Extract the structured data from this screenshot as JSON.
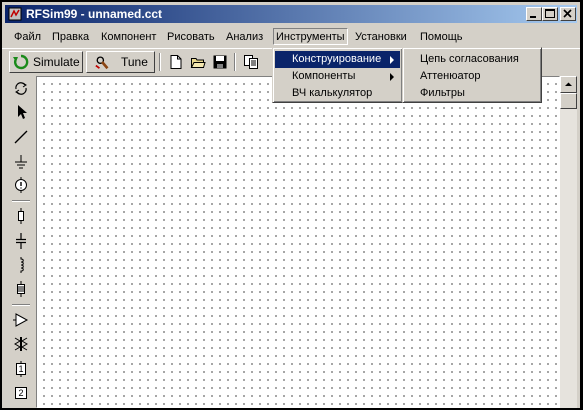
{
  "window": {
    "title": "RFSim99 - unnamed.cct"
  },
  "menubar": [
    {
      "label": "Файл"
    },
    {
      "label": "Правка"
    },
    {
      "label": "Компонент"
    },
    {
      "label": "Рисовать"
    },
    {
      "label": "Анализ"
    },
    {
      "label": "Инструменты",
      "open": true
    },
    {
      "label": "Установки"
    },
    {
      "label": "Помощь"
    }
  ],
  "toolbar": {
    "simulate_label": "Simulate",
    "tune_label": "Tune",
    "icons": [
      "simulate-icon",
      "tune-icon",
      "new-file-icon",
      "open-folder-icon",
      "save-disk-icon",
      "copy-icon"
    ]
  },
  "palette": {
    "tools": [
      "rotate-icon",
      "pointer-icon",
      "wire-icon",
      "ground-icon",
      "voltage-source-icon",
      "resistor-icon",
      "capacitor-icon",
      "inductor-icon",
      "crystal-icon",
      "amplifier-icon",
      "transformer-icon",
      "port-1-icon",
      "port-2-icon"
    ],
    "port_labels": [
      "1",
      "2"
    ]
  },
  "tools_menu": {
    "items": [
      {
        "label": "Конструирование",
        "has_submenu": true,
        "highlighted": true
      },
      {
        "label": "Компоненты",
        "has_submenu": true
      },
      {
        "label": "ВЧ калькулятор",
        "has_submenu": false
      }
    ]
  },
  "design_submenu": {
    "items": [
      {
        "label": "Цепь согласования"
      },
      {
        "label": "Аттенюатор"
      },
      {
        "label": "Фильтры"
      }
    ]
  },
  "colors": {
    "titlebar_start": "#0a246a",
    "titlebar_end": "#a6caf0",
    "highlight": "#0a246a",
    "face": "#d4d0c8"
  }
}
